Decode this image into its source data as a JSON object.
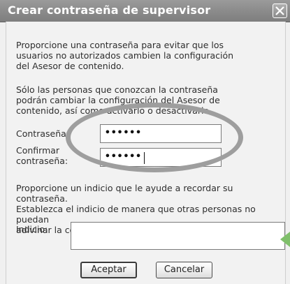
{
  "dialog": {
    "title": "Crear contraseña de supervisor",
    "close_glyph": "✕"
  },
  "intro": {
    "para1": "Proporcione una contraseña para evitar que los\nusuarios no autorizados cambien la configuración\ndel Asesor de contenido.",
    "para2": "Sólo las personas que conozcan la contraseña\npodrán cambiar la configuración del Asesor de\ncontenido, así como activarlo o desactivarlo."
  },
  "password": {
    "label": "Contraseña:",
    "value": "••••••"
  },
  "confirm": {
    "label": "Confirmar\ncontraseña:",
    "value": "••••••"
  },
  "hint_help": "Proporcione un indicio que le ayude a recordar su contraseña.\nEstablezca el indicio de manera que otras personas no puedan\nadivinar la contraseña fácilmente.",
  "hint": {
    "label": "Indicio:",
    "value": ""
  },
  "buttons": {
    "accept": "Aceptar",
    "cancel": "Cancelar"
  },
  "colors": {
    "highlight_ellipse": "#9e9e9e",
    "pointer_arrow": "#7fbf6a"
  },
  "icons": {
    "close": "close-icon",
    "arrow": "arrow-pointer-icon"
  }
}
